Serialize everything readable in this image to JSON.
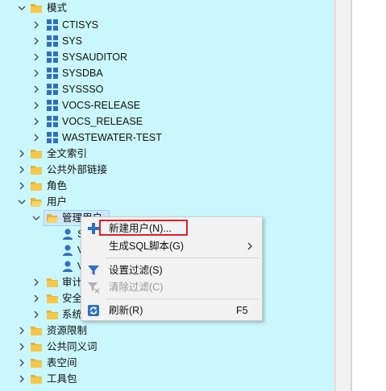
{
  "tree": {
    "schema_node": "模式",
    "schemas": [
      "CTISYS",
      "SYS",
      "SYSAUDITOR",
      "SYSDBA",
      "SYSSSO",
      "VOCS-RELEASE",
      "VOCS_RELEASE",
      "WASTEWATER-TEST"
    ],
    "folders_a": [
      "全文索引",
      "公共外部链接",
      "角色"
    ],
    "users_node": "用户",
    "user_sub": "管理用户",
    "user_items": [
      "S",
      "V",
      "V"
    ],
    "subfolders": [
      "审计",
      "安全",
      "系统"
    ],
    "folders_b": [
      "资源限制",
      "公共同义词",
      "表空间",
      "工具包"
    ]
  },
  "context_menu": {
    "new_user": "新建用户(N)...",
    "generate_sql": "生成SQL脚本(G)",
    "set_filter": "设置过滤(S)",
    "clear_filter": "清除过滤(C)",
    "refresh": "刷新(R)",
    "refresh_key": "F5"
  },
  "colors": {
    "tree_bg": "#c9f7fd",
    "highlight_border": "#e0202a",
    "folder": "#e8b537"
  }
}
